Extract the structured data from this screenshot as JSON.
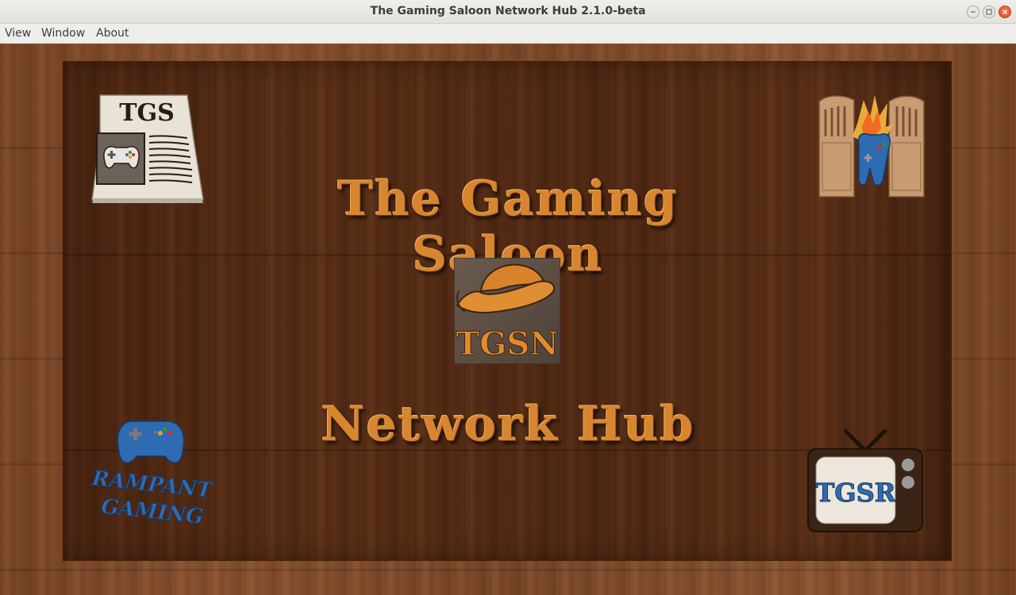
{
  "window": {
    "title": "The Gaming Saloon Network Hub 2.1.0-beta",
    "controls": [
      "minimize",
      "maximize",
      "close"
    ]
  },
  "menu": {
    "items": [
      {
        "label": "View"
      },
      {
        "label": "Window"
      },
      {
        "label": "About"
      }
    ]
  },
  "hub": {
    "heading_top": "The Gaming Saloon",
    "heading_bottom": "Network Hub",
    "center_logo_text": "TGSN",
    "tiles": {
      "news": {
        "text": "TGS",
        "icon": "newspaper-gamepad-icon"
      },
      "doors": {
        "icon": "saloon-doors-explosion-icon"
      },
      "rampant": {
        "line1": "RAMPANT",
        "line2": "GAMING",
        "icon": "rampant-gaming-logo"
      },
      "tv": {
        "text": "TGSR",
        "icon": "retro-tv-icon"
      }
    }
  },
  "colors": {
    "accent_orange": "#d7862f",
    "wood_dark": "#522a14",
    "wood_light": "#8a5230",
    "brand_blue": "#2f6bb0",
    "close_red": "#df4a1c"
  }
}
